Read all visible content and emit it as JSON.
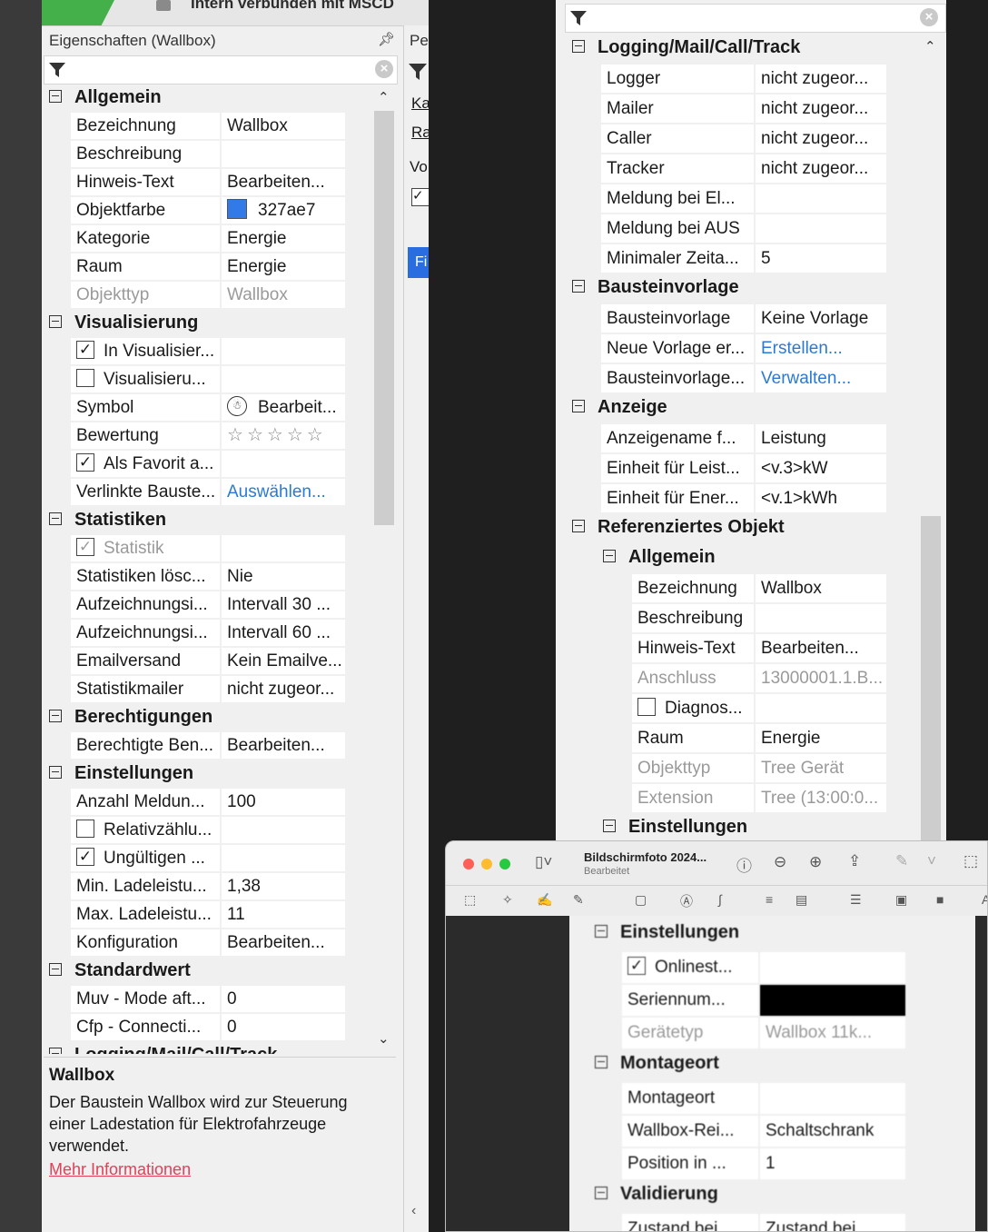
{
  "left": {
    "connection_text": "Intern verbunden mit MSCD",
    "panel_title": "Eigenschaften (Wallbox)",
    "pin_icon": "pin-icon",
    "side_tabs": [
      "Pe",
      "Ka",
      "Ra",
      "Vo",
      "Fi"
    ],
    "groups": [
      {
        "title": "Allgemein",
        "rows": [
          {
            "label": "Bezeichnung",
            "value": "Wallbox"
          },
          {
            "label": "Beschreibung",
            "value": ""
          },
          {
            "label": "Hinweis-Text",
            "value": "Bearbeiten..."
          },
          {
            "label": "Objektfarbe",
            "value": "327ae7",
            "swatch": "#327ae7"
          },
          {
            "label": "Kategorie",
            "value": "Energie"
          },
          {
            "label": "Raum",
            "value": "Energie"
          },
          {
            "label": "Objekttyp",
            "value": "Wallbox",
            "disabled": true
          }
        ]
      },
      {
        "title": "Visualisierung",
        "rows": [
          {
            "label": "In Visualisier...",
            "value": "",
            "checkbox": true,
            "checked": true
          },
          {
            "label": "Visualisieru...",
            "value": "",
            "checkbox": true,
            "checked": false
          },
          {
            "label": "Symbol",
            "value": "Bearbeit...",
            "icon": "robot-icon"
          },
          {
            "label": "Bewertung",
            "value": "",
            "rating": 0,
            "rating_max": 5
          },
          {
            "label": "Als Favorit a...",
            "value": "",
            "checkbox": true,
            "checked": true
          },
          {
            "label": "Verlinkte Bauste...",
            "value": "Auswählen...",
            "link": true
          }
        ]
      },
      {
        "title": "Statistiken",
        "rows": [
          {
            "label": "Statistik",
            "value": "",
            "checkbox": true,
            "checked": true,
            "disabled": true
          },
          {
            "label": "Statistiken lösc...",
            "value": "Nie"
          },
          {
            "label": "Aufzeichnungsi...",
            "value": "Intervall 30 ..."
          },
          {
            "label": "Aufzeichnungsi...",
            "value": "Intervall 60 ..."
          },
          {
            "label": "Emailversand",
            "value": "Kein Emailve..."
          },
          {
            "label": "Statistikmailer",
            "value": "nicht zugeor..."
          }
        ]
      },
      {
        "title": "Berechtigungen",
        "rows": [
          {
            "label": "Berechtigte Ben...",
            "value": "Bearbeiten..."
          }
        ]
      },
      {
        "title": "Einstellungen",
        "rows": [
          {
            "label": "Anzahl Meldun...",
            "value": "100"
          },
          {
            "label": "Relativzählu...",
            "value": "",
            "checkbox": true,
            "checked": false
          },
          {
            "label": "Ungültigen ...",
            "value": "",
            "checkbox": true,
            "checked": true
          },
          {
            "label": "Min. Ladeleistu...",
            "value": "1,38"
          },
          {
            "label": "Max. Ladeleistu...",
            "value": "11"
          },
          {
            "label": "Konfiguration",
            "value": "Bearbeiten..."
          }
        ]
      },
      {
        "title": "Standardwert",
        "rows": [
          {
            "label": "Muv - Mode aft...",
            "value": "0"
          },
          {
            "label": "Cfp - Connecti...",
            "value": "0"
          }
        ]
      },
      {
        "title": "Logging/Mail/Call/Track",
        "rows": []
      }
    ],
    "description": {
      "title": "Wallbox",
      "text": "Der Baustein Wallbox wird zur Steuerung einer Ladestation für Elektrofahrzeuge verwendet.",
      "link": "Mehr Informationen"
    }
  },
  "right": {
    "groups": [
      {
        "title": "Logging/Mail/Call/Track",
        "rows": [
          {
            "label": "Logger",
            "value": "nicht zugeor..."
          },
          {
            "label": "Mailer",
            "value": "nicht zugeor..."
          },
          {
            "label": "Caller",
            "value": "nicht zugeor..."
          },
          {
            "label": "Tracker",
            "value": "nicht zugeor..."
          },
          {
            "label": "Meldung bei El...",
            "value": ""
          },
          {
            "label": "Meldung bei AUS",
            "value": ""
          },
          {
            "label": "Minimaler Zeita...",
            "value": "5"
          }
        ]
      },
      {
        "title": "Bausteinvorlage",
        "rows": [
          {
            "label": "Bausteinvorlage",
            "value": "Keine Vorlage"
          },
          {
            "label": "Neue Vorlage er...",
            "value": "Erstellen...",
            "link": true
          },
          {
            "label": "Bausteinvorlage...",
            "value": "Verwalten...",
            "link": true
          }
        ]
      },
      {
        "title": "Anzeige",
        "rows": [
          {
            "label": "Anzeigename f...",
            "value": "Leistung"
          },
          {
            "label": "Einheit für Leist...",
            "value": "<v.3>kW"
          },
          {
            "label": "Einheit für Ener...",
            "value": "<v.1>kWh"
          }
        ]
      },
      {
        "title": "Referenziertes Objekt",
        "rows": []
      }
    ],
    "sub_groups": [
      {
        "title": "Allgemein",
        "rows": [
          {
            "label": "Bezeichnung",
            "value": "Wallbox"
          },
          {
            "label": "Beschreibung",
            "value": ""
          },
          {
            "label": "Hinweis-Text",
            "value": "Bearbeiten..."
          },
          {
            "label": "Anschluss",
            "value": "13000001.1.B...",
            "disabled": true
          },
          {
            "label": "Diagnos...",
            "value": "",
            "checkbox": true,
            "checked": false
          },
          {
            "label": "Raum",
            "value": "Energie"
          },
          {
            "label": "Objekttyp",
            "value": "Tree Gerät",
            "disabled": true
          },
          {
            "label": "Extension",
            "value": "Tree (13:00:0...",
            "disabled": true
          }
        ]
      },
      {
        "title": "Einstellungen",
        "rows": []
      }
    ]
  },
  "mac": {
    "title": "Bildschirmfoto 2024...",
    "subtitle": "Bearbeitet",
    "traffic": [
      "#ff5f57",
      "#febc2e",
      "#28c840"
    ],
    "toolbar_icons": [
      "sidebar-icon",
      "info-icon",
      "zoom-out-icon",
      "zoom-in-icon",
      "share-icon",
      "markup-icon",
      "rotate-icon"
    ],
    "markup_icons": [
      "select-icon",
      "magic-icon",
      "sketch-icon",
      "draw-icon",
      "shapes-icon",
      "text-icon",
      "sign-icon",
      "adjust-icon",
      "page-icon",
      "lines-icon",
      "border-icon",
      "fill-icon",
      "font-icon"
    ],
    "groups": [
      {
        "title": "Einstellungen",
        "rows": [
          {
            "label": "Onlinest...",
            "value": "",
            "checkbox": true,
            "checked": true
          },
          {
            "label": "Seriennum...",
            "value": "",
            "redacted": true
          },
          {
            "label": "Gerätetyp",
            "value": "Wallbox 11k...",
            "disabled": true
          }
        ]
      },
      {
        "title": "Montageort",
        "rows": [
          {
            "label": "Montageort",
            "value": ""
          },
          {
            "label": "Wallbox-Rei...",
            "value": "Schaltschrank"
          },
          {
            "label": "Position in ...",
            "value": "1"
          }
        ]
      },
      {
        "title": "Validierung",
        "rows": [
          {
            "label": "Zustand bei",
            "value": "Zustand bei"
          }
        ]
      }
    ]
  }
}
